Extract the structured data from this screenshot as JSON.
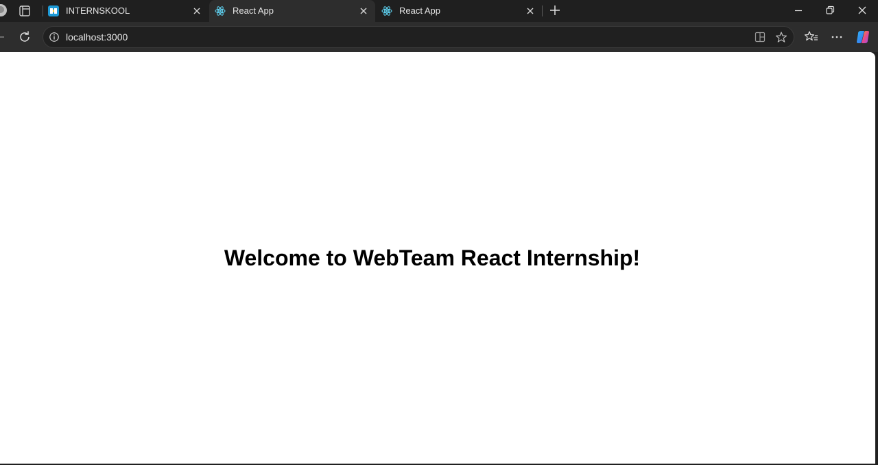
{
  "browser": {
    "tabs": [
      {
        "title": "INTERNSKOOL",
        "active": false,
        "favicon": "internskool-favicon-icon"
      },
      {
        "title": "React App",
        "active": true,
        "favicon": "react-favicon-icon"
      },
      {
        "title": "React App",
        "active": false,
        "favicon": "react-favicon-icon"
      }
    ],
    "address": {
      "url": "localhost:3000"
    },
    "colors": {
      "frame": "#1f1f1f",
      "toolbar": "#2d2d2d",
      "page_bg": "#ffffff"
    }
  },
  "page": {
    "heading": "Welcome to WebTeam React Internship!"
  }
}
